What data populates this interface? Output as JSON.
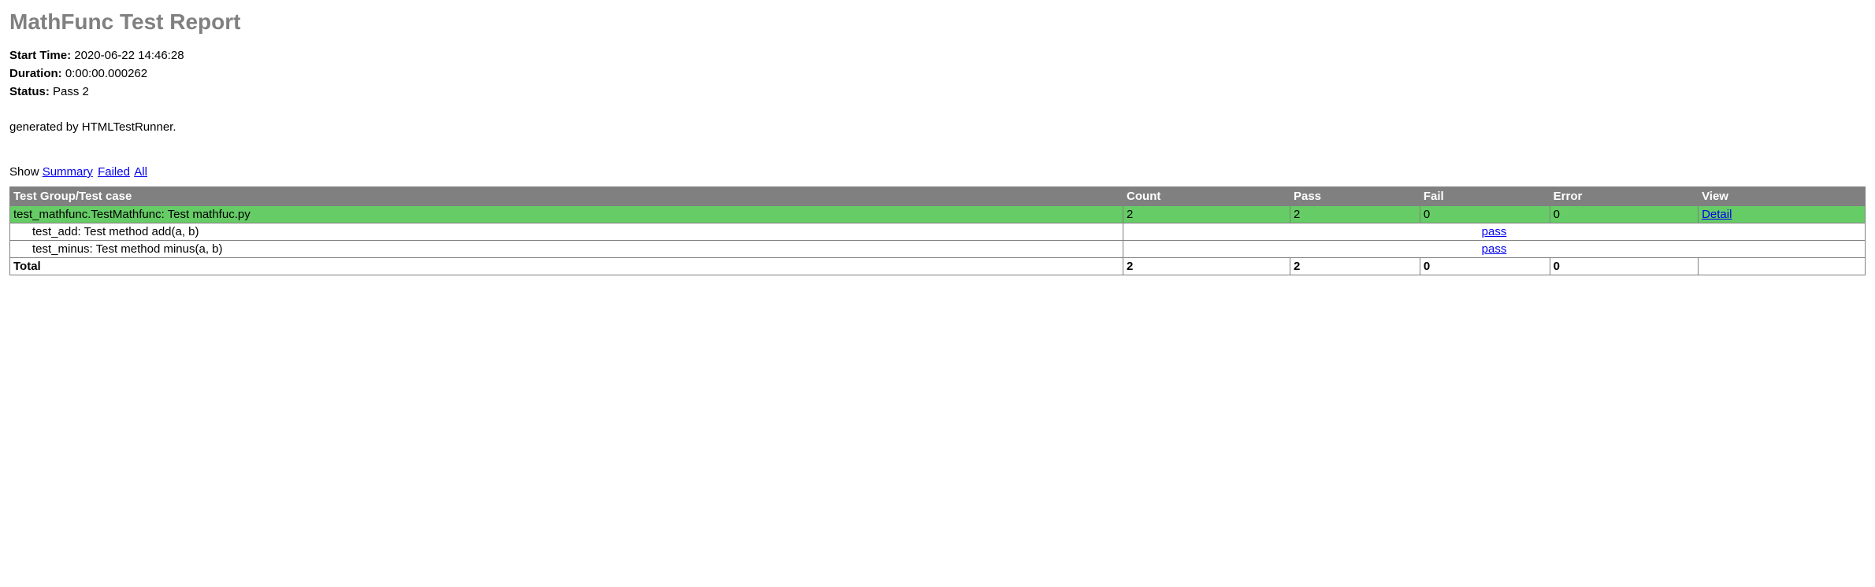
{
  "title": "MathFunc Test Report",
  "meta": {
    "start_time_label": "Start Time:",
    "start_time_value": "2020-06-22 14:46:28",
    "duration_label": "Duration:",
    "duration_value": "0:00:00.000262",
    "status_label": "Status:",
    "status_value": "Pass 2"
  },
  "generated_by": "generated by HTMLTestRunner.",
  "show": {
    "label": "Show",
    "summary": "Summary",
    "failed": "Failed",
    "all": "All"
  },
  "table": {
    "headers": {
      "group": "Test Group/Test case",
      "count": "Count",
      "pass": "Pass",
      "fail": "Fail",
      "error": "Error",
      "view": "View"
    },
    "group": {
      "name": "test_mathfunc.TestMathfunc: Test mathfuc.py",
      "count": "2",
      "pass": "2",
      "fail": "0",
      "error": "0",
      "view_link": "Detail"
    },
    "cases": [
      {
        "name": "test_add: Test method add(a, b)",
        "result": "pass"
      },
      {
        "name": "test_minus: Test method minus(a, b)",
        "result": "pass"
      }
    ],
    "total": {
      "label": "Total",
      "count": "2",
      "pass": "2",
      "fail": "0",
      "error": "0"
    }
  }
}
